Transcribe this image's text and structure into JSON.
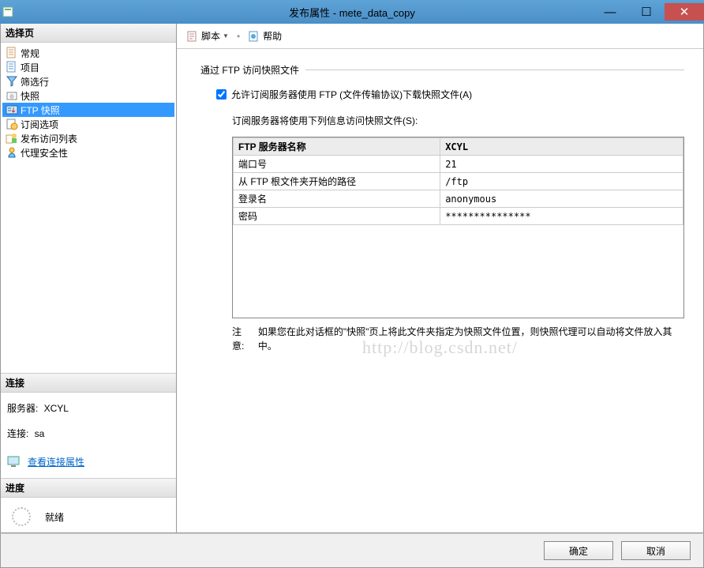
{
  "window": {
    "title": "发布属性 - mete_data_copy"
  },
  "left": {
    "select_page": "选择页",
    "tree": [
      {
        "label": "常规",
        "icon": "sheet"
      },
      {
        "label": "项目",
        "icon": "sheet-blue"
      },
      {
        "label": "筛选行",
        "icon": "filter"
      },
      {
        "label": "快照",
        "icon": "snapshot"
      },
      {
        "label": "FTP 快照",
        "icon": "ftp",
        "selected": true
      },
      {
        "label": "订阅选项",
        "icon": "options"
      },
      {
        "label": "发布访问列表",
        "icon": "access"
      },
      {
        "label": "代理安全性",
        "icon": "security"
      }
    ],
    "connection_header": "连接",
    "server_label": "服务器:",
    "server_value": "XCYL",
    "conn_label": "连接:",
    "conn_value": "sa",
    "view_props": "查看连接属性",
    "progress_header": "进度",
    "progress_status": "就绪"
  },
  "toolbar": {
    "script_label": "脚本",
    "help_label": "帮助"
  },
  "main": {
    "group_title": "通过 FTP 访问快照文件",
    "checkbox_label": "允许订阅服务器使用 FTP (文件传输协议)下载快照文件(A)",
    "info_text": "订阅服务器将使用下列信息访问快照文件(S):",
    "table": [
      {
        "k": "FTP 服务器名称",
        "v": "XCYL"
      },
      {
        "k": "端口号",
        "v": "21"
      },
      {
        "k": "从 FTP 根文件夹开始的路径",
        "v": "/ftp"
      },
      {
        "k": "登录名",
        "v": "anonymous"
      },
      {
        "k": "密码",
        "v": "***************"
      }
    ],
    "note_label": "注意:",
    "note_text": "如果您在此对话框的\"快照\"页上将此文件夹指定为快照文件位置，则快照代理可以自动将文件放入其中。",
    "watermark": "http://blog.csdn.net/"
  },
  "footer": {
    "ok": "确定",
    "cancel": "取消"
  }
}
